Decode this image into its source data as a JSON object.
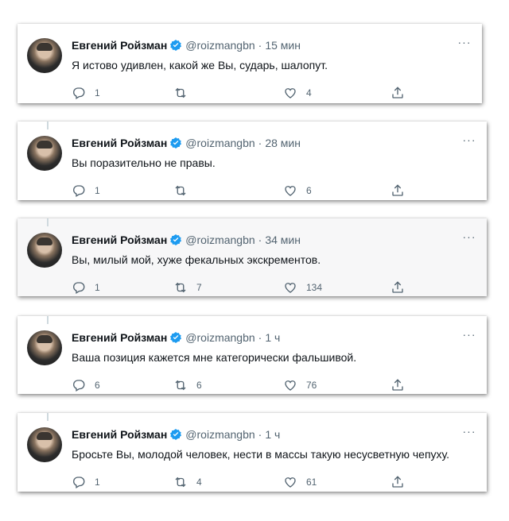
{
  "author": {
    "name": "Евгений Ройзман",
    "handle": "@roizmangbn"
  },
  "colors": {
    "verified": "#1d9bf0",
    "secondary_text": "#536471",
    "primary_text": "#0f1419"
  },
  "tweets": [
    {
      "time": "15 мин",
      "text": "Я истово удивлен, какой же Вы, сударь, шалопут.",
      "replies": "1",
      "retweets": "",
      "likes": "4"
    },
    {
      "time": "28 мин",
      "text": "Вы поразительно не правы.",
      "replies": "1",
      "retweets": "",
      "likes": "6"
    },
    {
      "time": "34 мин",
      "text": "Вы, милый мой, хуже фекальных экскрементов.",
      "replies": "1",
      "retweets": "7",
      "likes": "134"
    },
    {
      "time": "1 ч",
      "text": "Ваша позиция кажется мне категорически фальшивой.",
      "replies": "6",
      "retweets": "6",
      "likes": "76"
    },
    {
      "time": "1 ч",
      "text": "Бросьте Вы, молодой человек, нести в массы такую несусветную чепуху.",
      "replies": "1",
      "retweets": "4",
      "likes": "61"
    }
  ]
}
